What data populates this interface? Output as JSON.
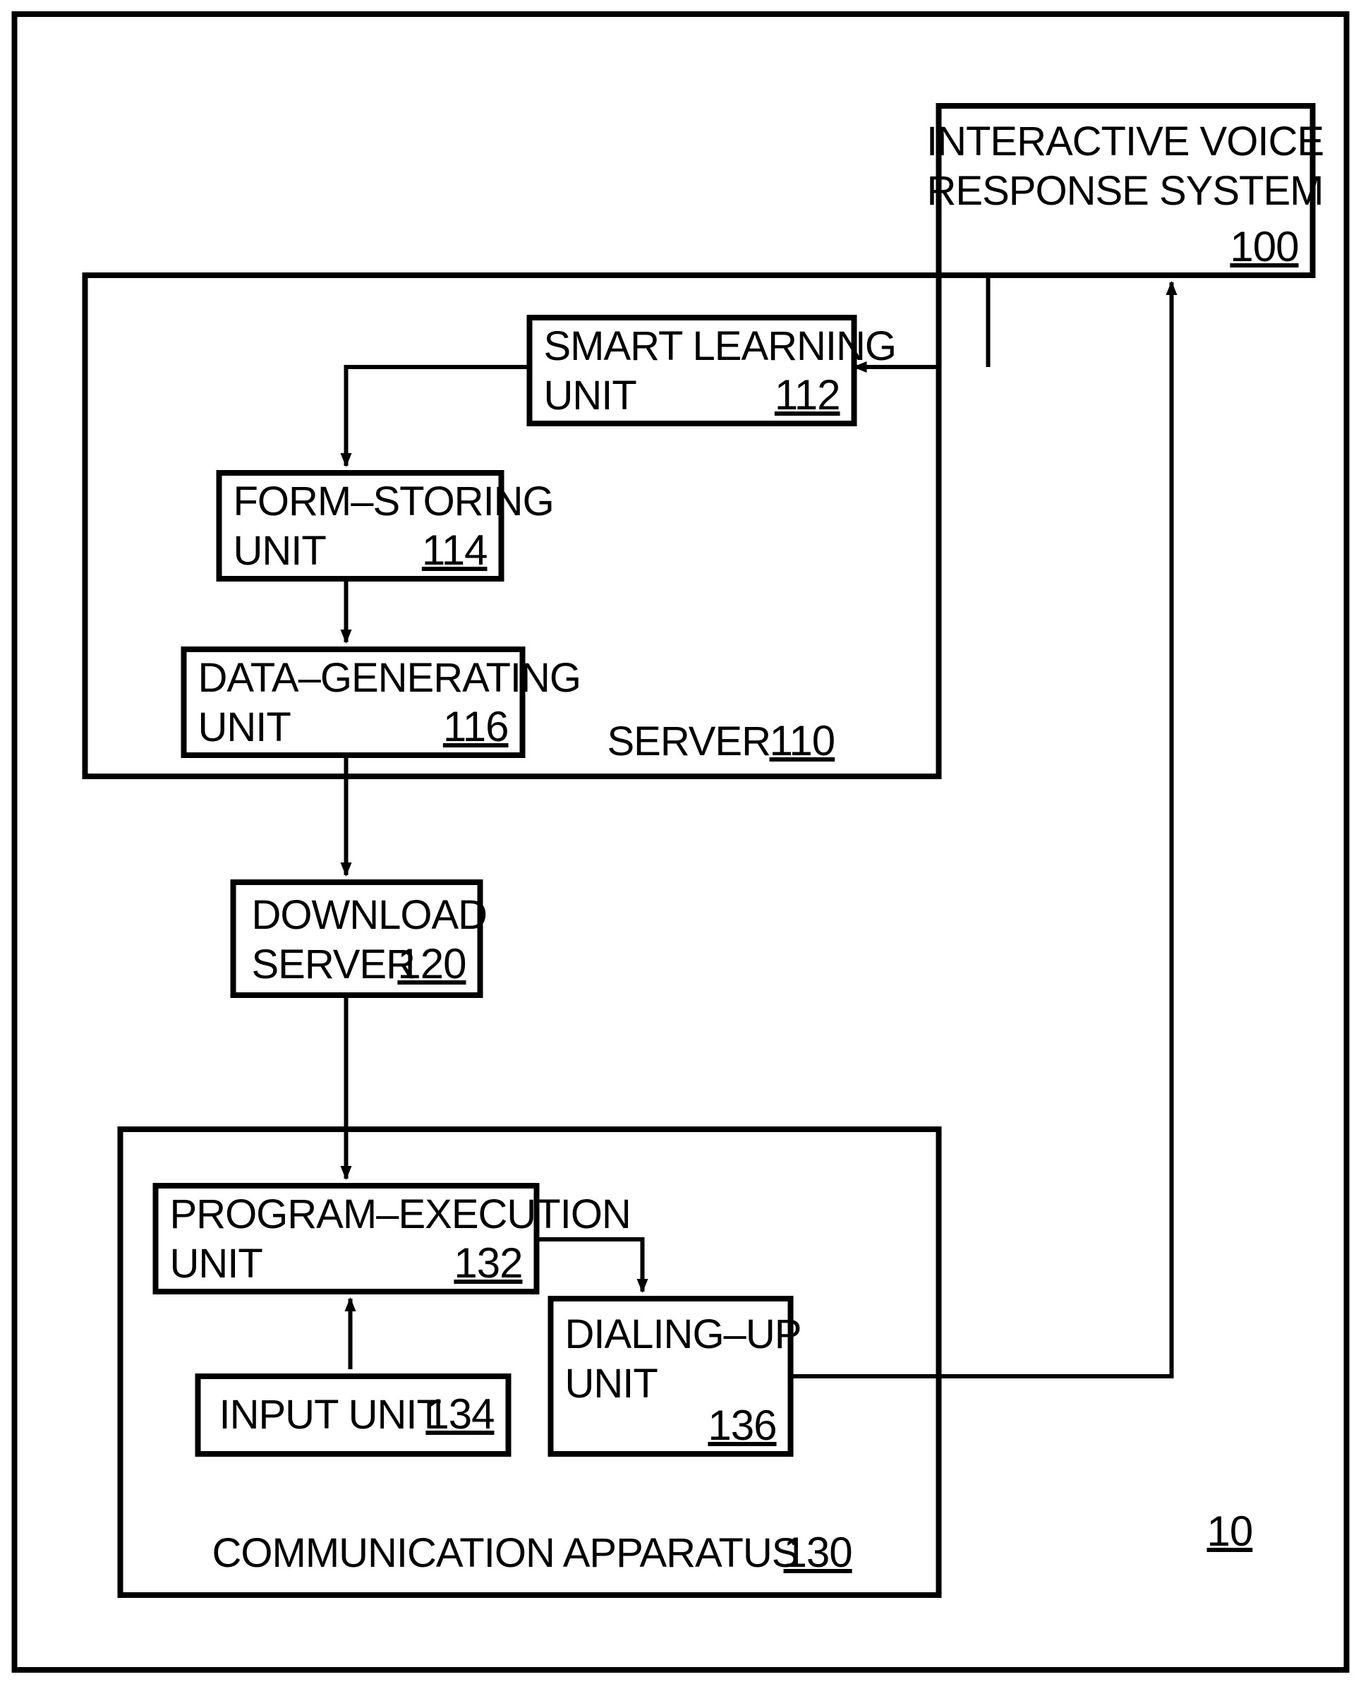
{
  "diagram": {
    "system_ref": "10",
    "ivr": {
      "line1": "INTERACTIVE VOICE",
      "line2": "RESPONSE SYSTEM",
      "ref": "100"
    },
    "server": {
      "label": "SERVER",
      "ref": "110",
      "smart_learning": {
        "line1": "SMART LEARNING",
        "line2": "UNIT",
        "ref": "112"
      },
      "form_storing": {
        "line1": "FORM–STORING",
        "line2": "UNIT",
        "ref": "114"
      },
      "data_generating": {
        "line1": "DATA–GENERATING",
        "line2": "UNIT",
        "ref": "116"
      }
    },
    "download_server": {
      "line1": "DOWNLOAD",
      "line2": "SERVER",
      "ref": "120"
    },
    "comm_apparatus": {
      "label": "COMMUNICATION APPARATUS",
      "ref": "130",
      "program_execution": {
        "line1": "PROGRAM–EXECUTION",
        "line2": "UNIT",
        "ref": "132"
      },
      "input_unit": {
        "label": "INPUT UNIT",
        "ref": "134"
      },
      "dialing_up": {
        "line1": "DIALING–UP",
        "line2": "UNIT",
        "ref": "136"
      }
    }
  }
}
